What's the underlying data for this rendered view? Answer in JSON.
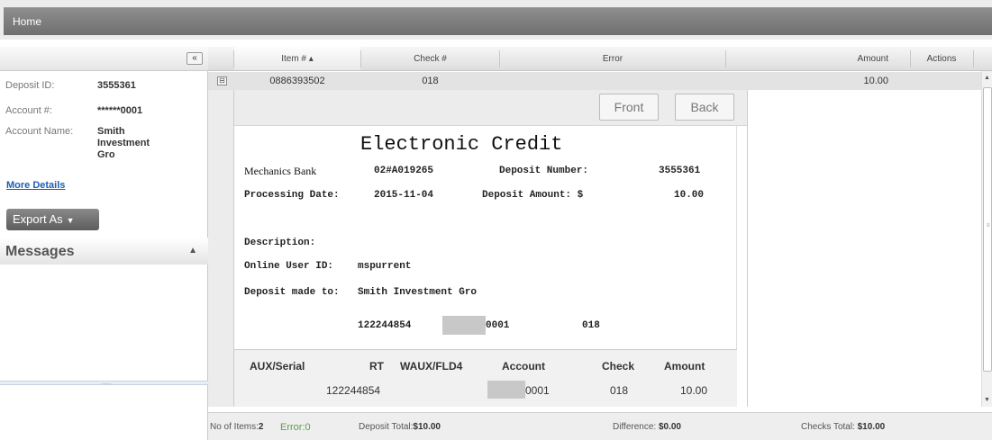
{
  "topbar": {
    "home_label": "Home"
  },
  "sidebar": {
    "collapse_icon": "«",
    "deposit_id_label": "Deposit ID:",
    "deposit_id_value": "3555361",
    "account_label": "Account #:",
    "account_value": "******0001",
    "account_name_label": "Account Name:",
    "account_name_value": "Smith\nInvestment\nGro",
    "more_details": "More Details",
    "export_label": "Export As",
    "messages_title": "Messages",
    "divider_dots": "....."
  },
  "grid": {
    "columns": {
      "item": "Item # ▴",
      "check": "Check #",
      "error": "Error",
      "amount": "Amount",
      "actions": "Actions"
    },
    "row": {
      "item": "0886393502",
      "check": "018",
      "amount": "10.00"
    }
  },
  "detail": {
    "front_label": "Front",
    "back_label": "Back",
    "credit": {
      "title": "Electronic Credit",
      "bank_name": "Mechanics Bank",
      "bank_code": "02#A019265",
      "deposit_number_label": "Deposit Number:",
      "deposit_number_value": "3555361",
      "processing_date_label": "Processing Date:",
      "processing_date_value": "2015-11-04",
      "deposit_amount_label": "Deposit Amount: $",
      "deposit_amount_value": "10.00",
      "description_label": "Description:",
      "online_user_label": "Online User ID:",
      "online_user_value": "mspurrent",
      "deposit_made_label": "Deposit made to:",
      "deposit_made_value": "Smith Investment Gro",
      "micr_rt": "122244854",
      "micr_account": "0001",
      "micr_check": "018"
    },
    "table": {
      "headers": [
        "AUX/Serial",
        "RT",
        "WAUX/FLD4",
        "Account",
        "Check",
        "Amount"
      ],
      "row": {
        "rt": "122244854",
        "account": "0001",
        "check": "018",
        "amount": "10.00"
      }
    }
  },
  "footer": {
    "items_label": "No of Items:",
    "items_value": "2",
    "error_label": "Error:",
    "error_value": "0",
    "deposit_total_label": "Deposit Total:",
    "deposit_total_value": "$10.00",
    "difference_label": "Difference:",
    "difference_value": "$0.00",
    "checks_total_label": "Checks Total:",
    "checks_total_value": "$10.00"
  },
  "colors": {
    "topbar": "#7a7a7a",
    "link": "#1a5fb4",
    "error_green": "#5aa04a"
  }
}
